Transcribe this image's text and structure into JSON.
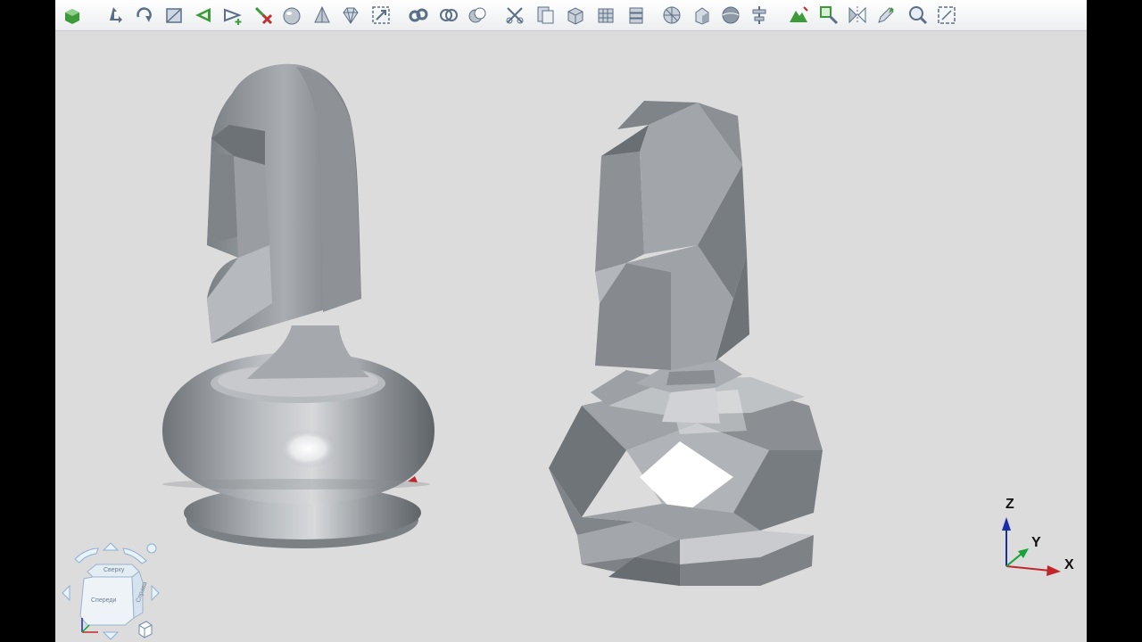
{
  "toolbar": {
    "buttons": [
      {
        "name": "shade-cube-icon",
        "color": "#3d9a3a"
      },
      {
        "name": "move-icon",
        "color": "#5a6e86"
      },
      {
        "name": "rotate-icon",
        "color": "#5a6e86"
      },
      {
        "name": "plane-icon",
        "color": "#5a6e86"
      },
      {
        "name": "triangle-arrow-icon",
        "color": "#3d9a3a"
      },
      {
        "name": "add-arrow-icon",
        "color": "#5a6e86"
      },
      {
        "name": "delete-point-icon",
        "color": "#c03030"
      },
      {
        "name": "sphere-icon",
        "color": "#5a6e86"
      },
      {
        "name": "cone-icon",
        "color": "#5a6e86"
      },
      {
        "name": "diamond-icon",
        "color": "#5a6e86"
      },
      {
        "name": "fit-view-icon",
        "color": "#5a6e86"
      },
      {
        "name": "chain-icon",
        "color": "#5a6e86"
      },
      {
        "name": "rings-icon",
        "color": "#5a6e86"
      },
      {
        "name": "intersect-icon",
        "color": "#5a6e86"
      },
      {
        "name": "cut-icon",
        "color": "#5a6e86"
      },
      {
        "name": "layers-icon",
        "color": "#5a6e86"
      },
      {
        "name": "boxes-icon",
        "color": "#5a6e86"
      },
      {
        "name": "grid-box-icon",
        "color": "#5a6e86"
      },
      {
        "name": "stack-icon",
        "color": "#5a6e86"
      },
      {
        "name": "disc-icon",
        "color": "#5a6e86"
      },
      {
        "name": "box-fold-icon",
        "color": "#5a6e86"
      },
      {
        "name": "sphere-shade-icon",
        "color": "#5a6e86"
      },
      {
        "name": "align-icon",
        "color": "#5a6e86"
      },
      {
        "name": "mountain-icon",
        "color": "#3d9a3a"
      },
      {
        "name": "zoom-area-icon",
        "color": "#3d9a3a"
      },
      {
        "name": "mirror-icon",
        "color": "#5a6e86"
      },
      {
        "name": "pen-icon",
        "color": "#5a6e86"
      },
      {
        "name": "magnify-icon",
        "color": "#5a6e86"
      },
      {
        "name": "frame-icon",
        "color": "#5a6e86"
      }
    ]
  },
  "viewport": {
    "background": "#dcdcdc",
    "model_color": "#9a9ea3"
  },
  "triad": {
    "z": "Z",
    "y": "Y",
    "x": "X",
    "z_color": "#1a2ea8",
    "y_color": "#15a33a",
    "x_color": "#c0262b"
  },
  "viewcube": {
    "front": "Спереди",
    "right": "Справа",
    "top": "Сверху"
  }
}
